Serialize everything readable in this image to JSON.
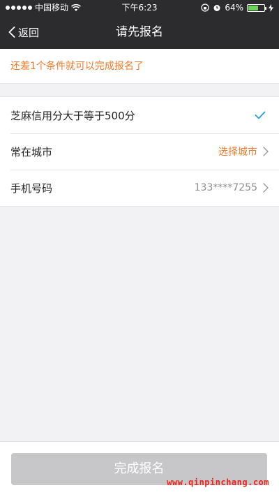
{
  "status_bar": {
    "carrier": "中国移动",
    "time": "下午6:23",
    "battery_text": "64%",
    "battery_level": 0.64,
    "battery_color": "#6bd25b"
  },
  "nav": {
    "back_label": "返回",
    "title": "请先报名"
  },
  "notice": "还差1个条件就可以完成报名了",
  "rows": [
    {
      "label": "芝麻信用分大于等于500分",
      "value": "",
      "icon": "check-icon"
    },
    {
      "label": "常在城市",
      "value": "选择城市",
      "icon": "chevron-right-icon"
    },
    {
      "label": "手机号码",
      "value": "133****7255",
      "icon": "chevron-right-icon"
    }
  ],
  "submit_label": "完成报名",
  "watermark": "www.qinpinchang.com",
  "colors": {
    "accent_orange": "#f07a2a",
    "check_blue": "#2a9ee0",
    "nav_bg": "#2c2c2e",
    "disabled_button": "#c7c7c9"
  }
}
